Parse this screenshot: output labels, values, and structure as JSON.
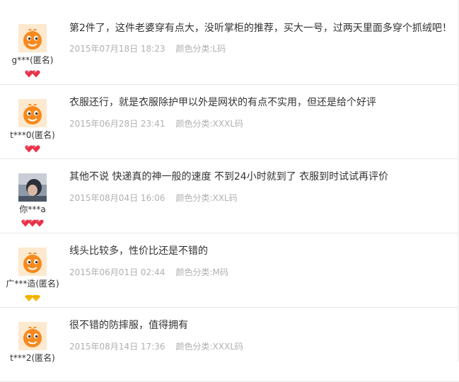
{
  "reviews": [
    {
      "username": "g***(匿名)",
      "content": "第2件了，这件老婆穿有点大，没听掌柜的推荐，买大一号，过两天里面多穿个抓绒吧！",
      "date": "2015年07月18日 18:23",
      "spec": "颜色分类:L码",
      "avatar": "taobao-mascot-avatar",
      "badge_type": "red-heart",
      "badge_count": 2
    },
    {
      "username": "t***0(匿名)",
      "content": "衣服还行，就是衣服除护甲以外是网状的有点不实用，但还是给个好评",
      "date": "2015年06月28日 23:41",
      "spec": "颜色分类:XXXL码",
      "avatar": "taobao-mascot-avatar",
      "badge_type": "red-heart",
      "badge_count": 2
    },
    {
      "username": "你***a",
      "content": "其他不说 快递真的神一般的速度 不到24小时就到了 衣服到时试试再评价",
      "date": "2015年08月04日 16:06",
      "spec": "颜色分类:XXL码",
      "avatar": "user-photo-avatar",
      "badge_type": "red-heart",
      "badge_count": 3
    },
    {
      "username": "广***造(匿名)",
      "content": "线头比较多，性价比还是不错的",
      "date": "2015年06月01日 02:44",
      "spec": "颜色分类:M码",
      "avatar": "taobao-mascot-avatar",
      "badge_type": "yellow-diamond",
      "badge_count": 2
    },
    {
      "username": "t***2(匿名)",
      "content": "很不错的防摔服，值得拥有",
      "date": "2015年08月14日 17:36",
      "spec": "颜色分类:XXXL码",
      "avatar": "taobao-mascot-avatar",
      "badge_type": "red-heart",
      "badge_count": 0
    }
  ],
  "colors": {
    "text": "#333333",
    "meta": "#b0b0b0",
    "divider": "#e6e6e6",
    "mascot_orange": "#f7891d",
    "heart_red": "#e8334a",
    "diamond_yellow": "#f5b800"
  }
}
